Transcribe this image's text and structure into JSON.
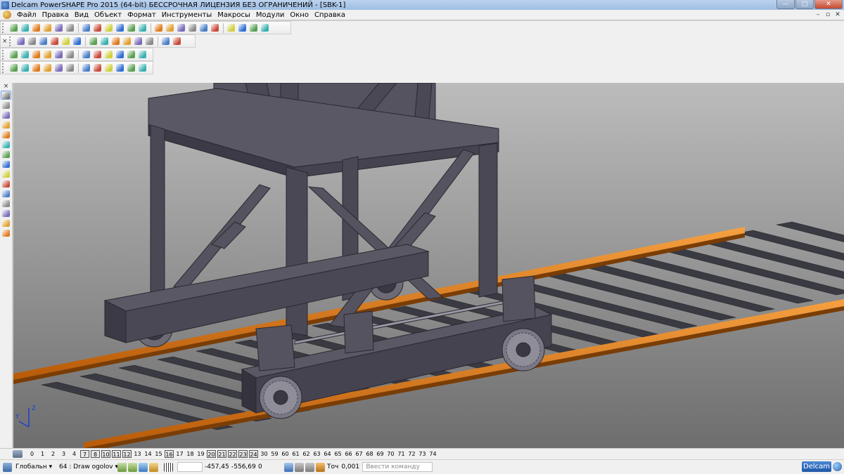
{
  "window": {
    "title": "Delcam PowerSHAPE Pro 2015 (64-bit) БЕССРОЧНАЯ ЛИЦЕНЗИЯ БЕЗ ОГРАНИЧЕНИЙ - [SBK-1]",
    "min_glyph": "—",
    "max_glyph": "□",
    "close_glyph": "✕"
  },
  "menu": {
    "items": [
      "Файл",
      "Правка",
      "Вид",
      "Объект",
      "Формат",
      "Инструменты",
      "Макросы",
      "Модули",
      "Окно",
      "Справка"
    ],
    "mdi_min": "–",
    "mdi_restore": "▫",
    "mdi_close": "✕"
  },
  "toolbars": {
    "close_glyph": "×"
  },
  "levels": {
    "items": [
      {
        "label": "0",
        "boxed": false
      },
      {
        "label": "1",
        "boxed": false
      },
      {
        "label": "2",
        "boxed": false
      },
      {
        "label": "3",
        "boxed": false
      },
      {
        "label": "4",
        "boxed": false
      },
      {
        "label": "7",
        "boxed": true
      },
      {
        "label": "8",
        "boxed": true
      },
      {
        "label": "10",
        "boxed": true
      },
      {
        "label": "11",
        "boxed": true
      },
      {
        "label": "12",
        "boxed": true
      },
      {
        "label": "13",
        "boxed": false
      },
      {
        "label": "14",
        "boxed": false
      },
      {
        "label": "15",
        "boxed": false
      },
      {
        "label": "16",
        "boxed": true
      },
      {
        "label": "17",
        "boxed": false
      },
      {
        "label": "18",
        "boxed": false
      },
      {
        "label": "19",
        "boxed": false
      },
      {
        "label": "20",
        "boxed": true
      },
      {
        "label": "21",
        "boxed": true
      },
      {
        "label": "22",
        "boxed": true
      },
      {
        "label": "23",
        "boxed": true
      },
      {
        "label": "24",
        "boxed": true
      },
      {
        "label": "30",
        "boxed": false
      },
      {
        "label": "59",
        "boxed": false
      },
      {
        "label": "60",
        "boxed": false
      },
      {
        "label": "61",
        "boxed": false
      },
      {
        "label": "62",
        "boxed": false
      },
      {
        "label": "63",
        "boxed": false
      },
      {
        "label": "64",
        "boxed": false
      },
      {
        "label": "65",
        "boxed": false
      },
      {
        "label": "66",
        "boxed": false
      },
      {
        "label": "67",
        "boxed": false
      },
      {
        "label": "68",
        "boxed": false
      },
      {
        "label": "69",
        "boxed": false
      },
      {
        "label": "70",
        "boxed": false
      },
      {
        "label": "71",
        "boxed": false
      },
      {
        "label": "72",
        "boxed": false
      },
      {
        "label": "73",
        "boxed": false
      },
      {
        "label": "74",
        "boxed": false
      }
    ]
  },
  "status": {
    "workplane": "Глобальн",
    "level": "64 : Draw ogolov",
    "x": "-457,45",
    "y": "-556,69",
    "z": "0",
    "tol_label": "Точ",
    "tol_value": "0,001",
    "command_placeholder": "Ввести команду",
    "brand": "Delcam"
  },
  "viewport": {
    "background_top": "#b8b8b8",
    "background_bottom": "#727272",
    "steel_color": "#4a4854",
    "rail_color": "#e07a1a",
    "axis_color": "#1a3fd0",
    "axis_labels": [
      "Z",
      "Y"
    ]
  }
}
